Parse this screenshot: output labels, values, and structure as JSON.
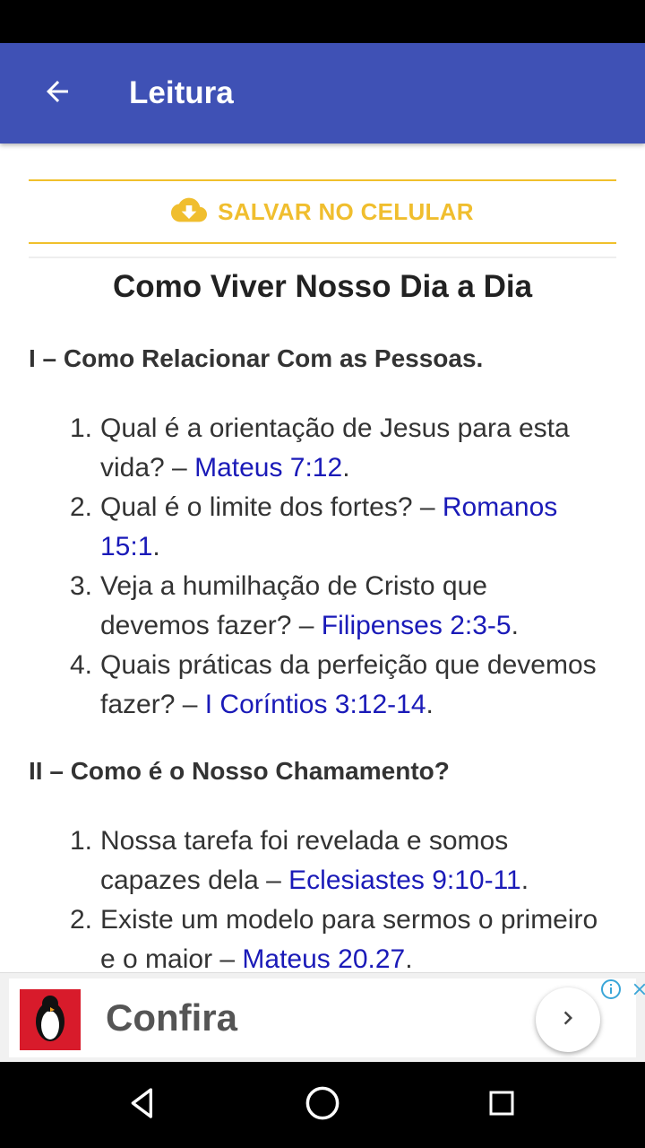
{
  "app_bar": {
    "title": "Leitura",
    "back_icon": "arrow-back-icon",
    "color": "#3f51b5"
  },
  "save": {
    "label": "SALVAR NO CELULAR",
    "icon": "cloud-download-icon",
    "color": "#f0be2e"
  },
  "document": {
    "title": "Como Viver Nosso Dia a Dia",
    "sections": [
      {
        "heading": "I – Como Relacionar Com as Pessoas.",
        "items": [
          {
            "num": "1.",
            "text": "Qual é a orientação de Jesus para esta vida? – ",
            "ref": "Mateus 7:12",
            "end": "."
          },
          {
            "num": "2.",
            "text": "Qual é o limite dos fortes? – ",
            "ref": "Romanos 15:1",
            "end": "."
          },
          {
            "num": "3.",
            "text": "Veja a humilhação de Cristo que devemos fazer? – ",
            "ref": "Filipenses 2:3-5",
            "end": "."
          },
          {
            "num": "4.",
            "text": "Quais práticas da perfeição que devemos fazer? – ",
            "ref": "I Coríntios 3:12-14",
            "end": "."
          }
        ]
      },
      {
        "heading": "II – Como é o Nosso Chamamento?",
        "items": [
          {
            "num": "1.",
            "text": "Nossa tarefa foi revelada e somos capazes dela – ",
            "ref": "Eclesiastes 9:10-11",
            "end": "."
          },
          {
            "num": "2.",
            "text": "Existe um modelo para sermos o primeiro e o maior – ",
            "ref": "Mateus 20.27",
            "end": "."
          }
        ]
      }
    ],
    "link_color": "#1a1ab8"
  },
  "ad": {
    "text": "Confira",
    "thumb_icon": "penguin-icon",
    "go_icon": "chevron-right-icon",
    "info_icon": "info-icon",
    "close_icon": "close-icon"
  },
  "nav": {
    "back_icon": "nav-back-icon",
    "home_icon": "nav-home-icon",
    "recents_icon": "nav-recents-icon"
  }
}
